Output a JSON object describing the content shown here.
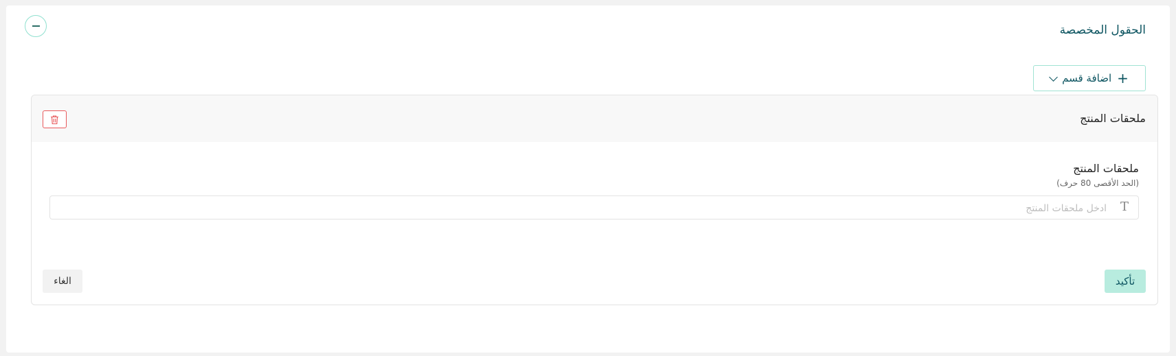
{
  "header": {
    "title": "الحقول المخصصة",
    "collapse_icon": "minus-icon"
  },
  "toolbar": {
    "add_section_label": "اضافة قسم",
    "add_icon": "plus-icon",
    "dropdown_icon": "chevron-down-icon"
  },
  "section": {
    "title": "ملحقات المنتج",
    "delete_icon": "trash-icon",
    "field": {
      "label": "ملحقات المنتج",
      "hint": "(الحد الأقصى 80 حرف)",
      "placeholder": "ادخل ملحقات المنتج",
      "value": "",
      "type_icon": "text-type-icon"
    },
    "confirm_label": "تأكيد",
    "cancel_label": "الغاء"
  },
  "colors": {
    "accent": "#0c5460",
    "border_accent": "#9fe3d3",
    "confirm_bg": "#b8ecdf",
    "danger": "#e8585a"
  }
}
